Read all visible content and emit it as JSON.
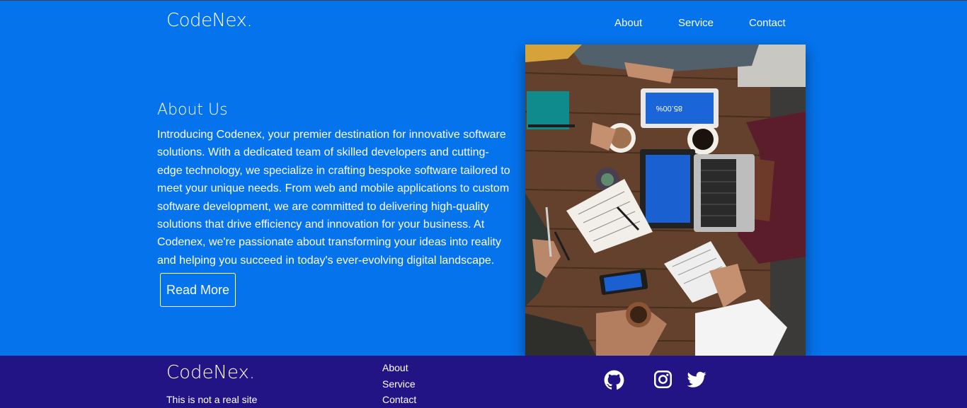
{
  "header": {
    "brand": "CodeNex.",
    "nav": [
      {
        "label": "About"
      },
      {
        "label": "Service"
      },
      {
        "label": "Contact"
      }
    ]
  },
  "about": {
    "title": "About Us",
    "body": "Introducing Codenex, your premier destination for innovative software solutions. With a dedicated team of skilled developers and cutting-edge technology, we specialize in crafting bespoke software tailored to meet your unique needs. From web and mobile applications to custom software development, we are committed to delivering high-quality solutions that drive efficiency and innovation for your business. At Codenex, we're passionate about transforming your ideas into reality and helping you succeed in today's ever-evolving digital landscape.",
    "button_label": "Read More",
    "tablet_value": "85.00%"
  },
  "footer": {
    "brand": "CodeNex.",
    "tagline": "This is not a real site",
    "links": [
      {
        "label": "About"
      },
      {
        "label": "Service"
      },
      {
        "label": "Contact"
      }
    ],
    "social_icons": [
      "github-icon",
      "instagram-icon",
      "twitter-icon"
    ]
  },
  "colors": {
    "page_bg": "#0573ec",
    "footer_bg": "#231485",
    "text": "#ffffff"
  }
}
